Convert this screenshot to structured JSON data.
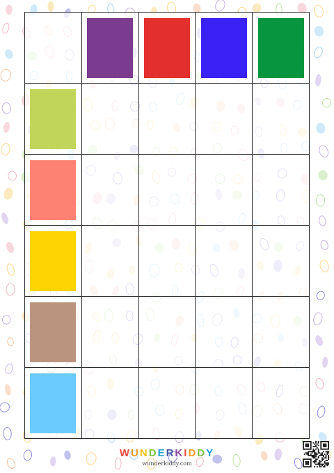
{
  "header_colors": [
    {
      "name": "purple",
      "hex": "#7b3b8e"
    },
    {
      "name": "red",
      "hex": "#e3302e"
    },
    {
      "name": "blue",
      "hex": "#3a22f6"
    },
    {
      "name": "green",
      "hex": "#07963f"
    }
  ],
  "row_colors": [
    {
      "name": "lime",
      "hex": "#c1d55a"
    },
    {
      "name": "salmon",
      "hex": "#fd8273"
    },
    {
      "name": "yellow",
      "hex": "#ffd500"
    },
    {
      "name": "brown",
      "hex": "#bb9480"
    },
    {
      "name": "light-blue",
      "hex": "#6bcbfe"
    }
  ],
  "footer": {
    "brand_letters": [
      "W",
      "U",
      "N",
      "D",
      "E",
      "R",
      "K",
      "I",
      "D",
      "D",
      "Y"
    ],
    "brand_colors": [
      "#e84a3c",
      "#f29a1f",
      "#f2c21b",
      "#7cc242",
      "#1fa0d8",
      "#3f57a6",
      "#8b4aa0",
      "#e84a3c",
      "#f29a1f",
      "#7cc242",
      "#1fa0d8"
    ],
    "url": "wunderkiddy.com"
  },
  "qr_icon": "qr-code-icon"
}
